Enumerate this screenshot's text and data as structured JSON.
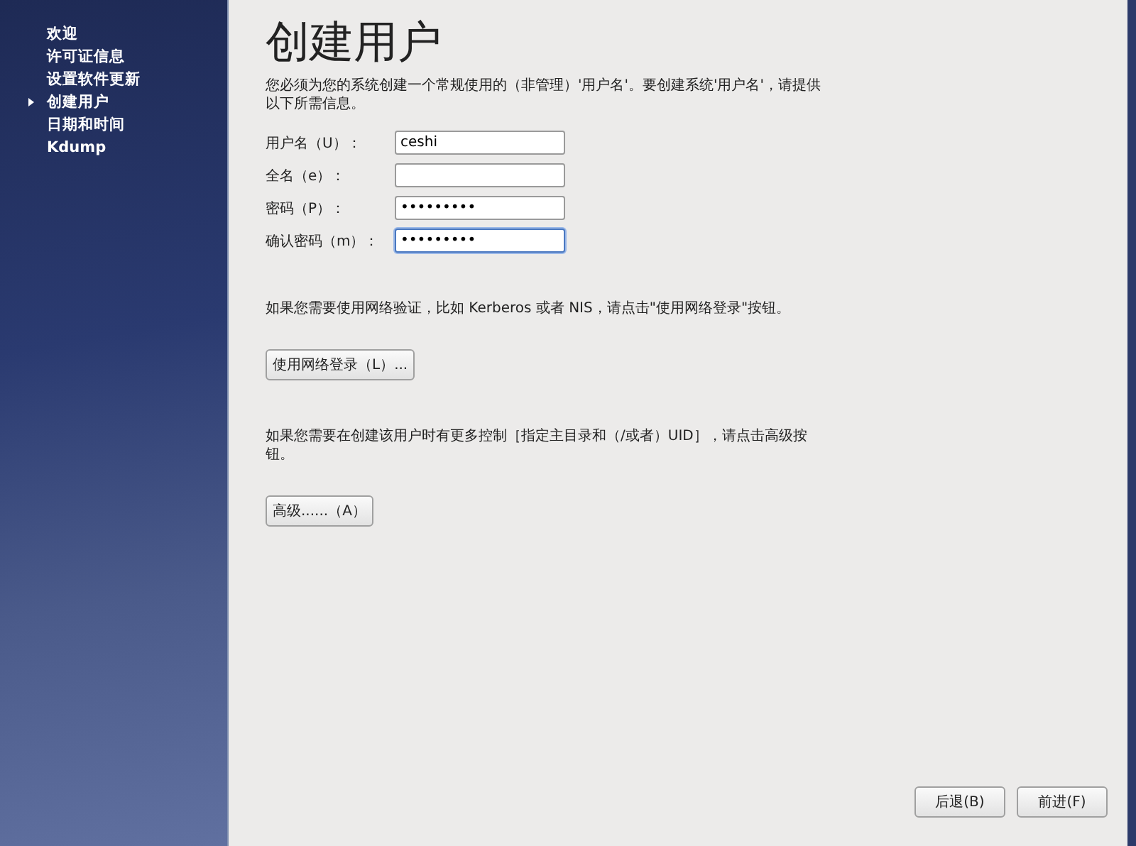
{
  "sidebar": {
    "items": [
      {
        "label": "欢迎",
        "selected": false
      },
      {
        "label": "许可证信息",
        "selected": false
      },
      {
        "label": "设置软件更新",
        "selected": false
      },
      {
        "label": "创建用户",
        "selected": true
      },
      {
        "label": "日期和时间",
        "selected": false
      },
      {
        "label": "Kdump",
        "selected": false
      }
    ]
  },
  "title": "创建用户",
  "intro": "您必须为您的系统创建一个常规使用的（非管理）'用户名'。要创建系统'用户名'，请提供以下所需信息。",
  "fields": [
    {
      "label": "用户名（U）：",
      "value": "ceshi",
      "focused": false
    },
    {
      "label": "全名（e）：",
      "focused": false
    },
    {
      "label": "密码（P）：",
      "value": "•••••••••",
      "focused": false
    },
    {
      "label": "确认密码（m）：",
      "value": "•••••••••",
      "focused": true
    }
  ],
  "network_note": "如果您需要使用网络验证，比如 Kerberos 或者 NIS，请点击\"使用网络登录\"按钮。",
  "network_button": "使用网络登录（L）...",
  "advanced_note": "如果您需要在创建该用户时有更多控制［指定主目录和（/或者）UID］，请点击高级按钮。",
  "advanced_button": "高级......（A）",
  "footer_buttons": [
    "后退(B)",
    "前进(F)"
  ]
}
